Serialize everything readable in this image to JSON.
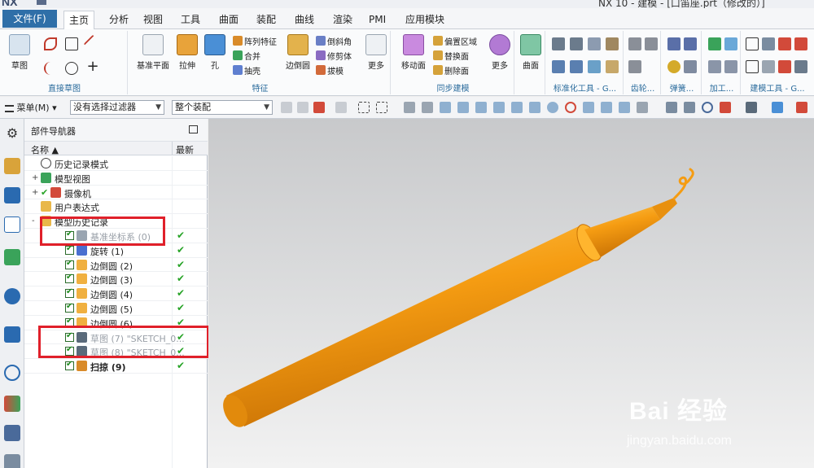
{
  "window": {
    "app_logo": "NX",
    "title": "NX 10 - 建模 - [口笛座.prt（修改的）]"
  },
  "menu_tabs": {
    "file": "文件(F)",
    "items": [
      "主页",
      "分析",
      "视图",
      "工具",
      "曲面",
      "装配",
      "曲线",
      "渲染",
      "PMI",
      "应用模块"
    ],
    "active": "主页"
  },
  "ribbon": {
    "groups": {
      "direct_sketch": "直接草图",
      "feature": "特征",
      "sync_modeling": "同步建模",
      "standard_tools": "标准化工具 - G...",
      "gear": "齿轮...",
      "spring": "弹簧...",
      "machining": "加工...",
      "modeling_tools": "建模工具 - G..."
    },
    "buttons": {
      "sketch": "草图",
      "datum_plane": "基准平面",
      "extrude": "拉伸",
      "hole": "孔",
      "pattern_feature": "阵列特征",
      "unite": "合并",
      "shell": "抽壳",
      "edge_blend": "边倒圆",
      "chamfer": "倒斜角",
      "trim_body": "修剪体",
      "draft": "拔模",
      "more1": "更多",
      "move_face": "移动面",
      "offset_region": "偏置区域",
      "replace_face": "替换面",
      "delete_face": "删除面",
      "more2": "更多",
      "surface": "曲面"
    }
  },
  "toolbar2": {
    "menu_label": "菜单(M)",
    "filter_value": "没有选择过滤器",
    "scope_value": "整个装配"
  },
  "navigator": {
    "title": "部件导航器",
    "col_name": "名称",
    "col_new": "最新",
    "rows": [
      {
        "label": "历史记录模式",
        "icon": "clock-icon",
        "level": 0
      },
      {
        "label": "模型视图",
        "icon": "model-view-icon",
        "level": 0,
        "expand": "+"
      },
      {
        "label": "摄像机",
        "icon": "camera-icon",
        "level": 0,
        "expand": "+"
      },
      {
        "label": "用户表达式",
        "icon": "folder-icon",
        "level": 0
      },
      {
        "label": "模型历史记录",
        "icon": "folder-icon",
        "level": 0,
        "expand": "-"
      },
      {
        "label": "基准坐标系 (0)",
        "icon": "csys-icon",
        "level": 1,
        "gray": true,
        "check": true
      },
      {
        "label": "旋转 (1)",
        "icon": "revolve-icon",
        "level": 1,
        "check": true
      },
      {
        "label": "边倒圆 (2)",
        "icon": "blend-icon",
        "level": 1,
        "check": true
      },
      {
        "label": "边倒圆 (3)",
        "icon": "blend-icon",
        "level": 1,
        "check": true
      },
      {
        "label": "边倒圆 (4)",
        "icon": "blend-icon",
        "level": 1,
        "check": true
      },
      {
        "label": "边倒圆 (5)",
        "icon": "blend-icon",
        "level": 1,
        "check": true
      },
      {
        "label": "边倒圆 (6)",
        "icon": "blend-icon",
        "level": 1,
        "check": true
      },
      {
        "label": "草图 (7) \"SKETCH_0...",
        "icon": "sketch-icon",
        "level": 1,
        "gray": true,
        "check": true
      },
      {
        "label": "草图 (8) \"SKETCH_0...",
        "icon": "sketch-icon",
        "level": 1,
        "gray": true,
        "check": true
      },
      {
        "label": "扫掠 (9)",
        "icon": "sweep-icon",
        "level": 1,
        "bold": true,
        "check": true
      }
    ]
  },
  "watermark": {
    "brand": "Bai 经验",
    "url": "jingyan.baidu.com"
  },
  "colors": {
    "file_tab": "#2f6fa8",
    "highlight_box": "#e0202a",
    "model": "#f59c12",
    "check_green": "#27a327"
  }
}
